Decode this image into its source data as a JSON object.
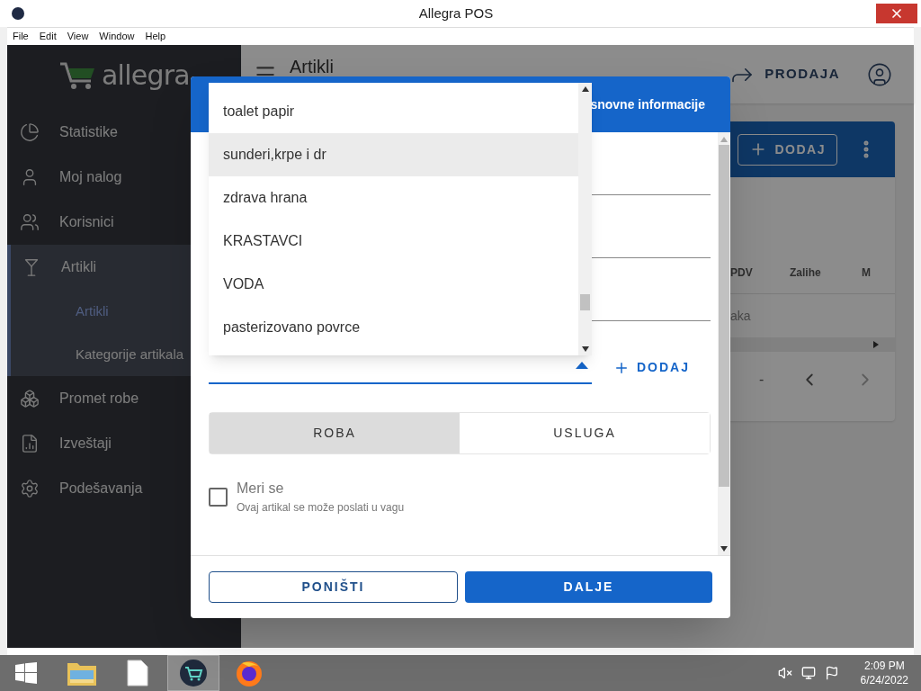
{
  "window": {
    "title": "Allegra POS"
  },
  "menu": [
    "File",
    "Edit",
    "View",
    "Window",
    "Help"
  ],
  "sidebar": {
    "logo": "allegra",
    "items": [
      {
        "label": "Statistike",
        "expanded": false
      },
      {
        "label": "Moj nalog",
        "expanded": false
      },
      {
        "label": "Korisnici",
        "expanded": false
      },
      {
        "label": "Artikli",
        "expanded": true,
        "children": [
          {
            "label": "Artikli",
            "selected": true
          },
          {
            "label": "Kategorije artikala",
            "selected": false
          }
        ]
      },
      {
        "label": "Promet robe",
        "expanded": false
      },
      {
        "label": "Izveštaji",
        "expanded": false
      },
      {
        "label": "Podešavanja",
        "expanded": false
      }
    ]
  },
  "header": {
    "title": "Artikli",
    "sale_button": "PRODAJA"
  },
  "card": {
    "add_button": "DODAJ",
    "columns": [
      "PDV",
      "Zalihe",
      "M"
    ],
    "empty_text": "aka",
    "pagination": "-"
  },
  "dialog": {
    "title": "snovne informacije",
    "text_fields": [
      {
        "focused": false
      },
      {
        "focused": false
      },
      {
        "focused": false
      }
    ],
    "category_field": {
      "focused": true,
      "open": true
    },
    "add_button": "DODAJ",
    "type_options": [
      {
        "label": "ROBA",
        "selected": true
      },
      {
        "label": "USLUGA",
        "selected": false
      }
    ],
    "weighed": {
      "label": "Meri se",
      "hint": "Ovaj artikal se može poslati u vagu",
      "checked": false
    },
    "buttons": {
      "cancel": "PONIŠTI",
      "next": "DALJE"
    }
  },
  "dropdown": [
    {
      "label": "toalet papir",
      "highlighted": false
    },
    {
      "label": "sunderi,krpe i dr",
      "highlighted": true
    },
    {
      "label": "zdrava hrana",
      "highlighted": false
    },
    {
      "label": "KRASTAVCI",
      "highlighted": false
    },
    {
      "label": "VODA",
      "highlighted": false
    },
    {
      "label": "pasterizovano povrce",
      "highlighted": false
    }
  ],
  "taskbar": {
    "apps": [
      {
        "active": false
      },
      {
        "active": false
      },
      {
        "active": false
      },
      {
        "active": true
      },
      {
        "active": false
      }
    ],
    "time": "2:09 PM",
    "date": "6/24/2022"
  }
}
